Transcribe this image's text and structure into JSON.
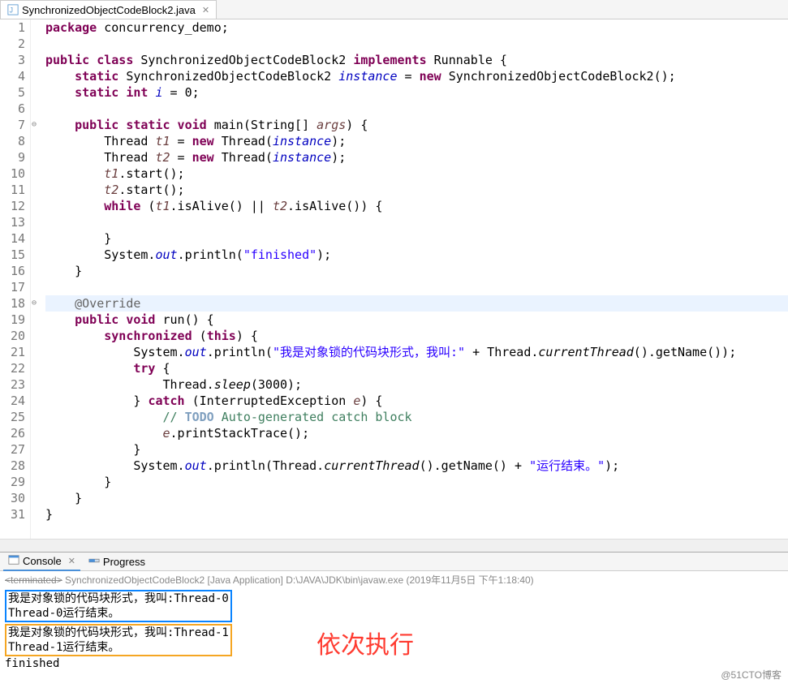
{
  "tab": {
    "filename": "SynchronizedObjectCodeBlock2.java"
  },
  "code": {
    "lines": [
      {
        "n": "1",
        "tokens": [
          [
            "kw",
            "package"
          ],
          [
            "",
            " concurrency_demo;"
          ]
        ]
      },
      {
        "n": "2",
        "tokens": []
      },
      {
        "n": "3",
        "tokens": [
          [
            "kw",
            "public class"
          ],
          [
            "",
            " "
          ],
          [
            "type",
            "SynchronizedObjectCodeBlock2"
          ],
          [
            "",
            " "
          ],
          [
            "kw",
            "implements"
          ],
          [
            "",
            " Runnable {"
          ]
        ]
      },
      {
        "n": "4",
        "tokens": [
          [
            "",
            "    "
          ],
          [
            "kw",
            "static"
          ],
          [
            "",
            " SynchronizedObjectCodeBlock2 "
          ],
          [
            "svar",
            "instance"
          ],
          [
            "",
            " = "
          ],
          [
            "kw",
            "new"
          ],
          [
            "",
            " SynchronizedObjectCodeBlock2();"
          ]
        ]
      },
      {
        "n": "5",
        "tokens": [
          [
            "",
            "    "
          ],
          [
            "kw",
            "static int"
          ],
          [
            "",
            " "
          ],
          [
            "svar",
            "i"
          ],
          [
            "",
            " = 0;"
          ]
        ]
      },
      {
        "n": "6",
        "tokens": []
      },
      {
        "n": "7",
        "fold": true,
        "tokens": [
          [
            "",
            "    "
          ],
          [
            "kw",
            "public static void"
          ],
          [
            "",
            " main(String[] "
          ],
          [
            "var",
            "args"
          ],
          [
            "",
            ") {"
          ]
        ]
      },
      {
        "n": "8",
        "tokens": [
          [
            "",
            "        Thread "
          ],
          [
            "var",
            "t1"
          ],
          [
            "",
            " = "
          ],
          [
            "kw",
            "new"
          ],
          [
            "",
            " Thread("
          ],
          [
            "svar",
            "instance"
          ],
          [
            "",
            ");"
          ]
        ]
      },
      {
        "n": "9",
        "tokens": [
          [
            "",
            "        Thread "
          ],
          [
            "var",
            "t2"
          ],
          [
            "",
            " = "
          ],
          [
            "kw",
            "new"
          ],
          [
            "",
            " Thread("
          ],
          [
            "svar",
            "instance"
          ],
          [
            "",
            ");"
          ]
        ]
      },
      {
        "n": "10",
        "tokens": [
          [
            "",
            "        "
          ],
          [
            "var",
            "t1"
          ],
          [
            "",
            ".start();"
          ]
        ]
      },
      {
        "n": "11",
        "tokens": [
          [
            "",
            "        "
          ],
          [
            "var",
            "t2"
          ],
          [
            "",
            ".start();"
          ]
        ]
      },
      {
        "n": "12",
        "tokens": [
          [
            "",
            "        "
          ],
          [
            "kw",
            "while"
          ],
          [
            "",
            " ("
          ],
          [
            "var",
            "t1"
          ],
          [
            "",
            ".isAlive() || "
          ],
          [
            "var",
            "t2"
          ],
          [
            "",
            ".isAlive()) {"
          ]
        ]
      },
      {
        "n": "13",
        "tokens": []
      },
      {
        "n": "14",
        "tokens": [
          [
            "",
            "        }"
          ]
        ]
      },
      {
        "n": "15",
        "tokens": [
          [
            "",
            "        System."
          ],
          [
            "svar",
            "out"
          ],
          [
            "",
            ".println("
          ],
          [
            "str",
            "\"finished\""
          ],
          [
            "",
            ");"
          ]
        ]
      },
      {
        "n": "16",
        "tokens": [
          [
            "",
            "    }"
          ]
        ]
      },
      {
        "n": "17",
        "tokens": []
      },
      {
        "n": "18",
        "fold": true,
        "hl": true,
        "tokens": [
          [
            "",
            "    "
          ],
          [
            "ann",
            "@Override"
          ]
        ]
      },
      {
        "n": "19",
        "tokens": [
          [
            "",
            "    "
          ],
          [
            "kw",
            "public void"
          ],
          [
            "",
            " run() {"
          ]
        ]
      },
      {
        "n": "20",
        "tokens": [
          [
            "",
            "        "
          ],
          [
            "kw",
            "synchronized"
          ],
          [
            "",
            " ("
          ],
          [
            "kw",
            "this"
          ],
          [
            "",
            ") {"
          ]
        ]
      },
      {
        "n": "21",
        "tokens": [
          [
            "",
            "            System."
          ],
          [
            "svar",
            "out"
          ],
          [
            "",
            ".println("
          ],
          [
            "str",
            "\"我是对象锁的代码块形式，我叫:\""
          ],
          [
            "",
            " + Thread."
          ],
          [
            "smeth",
            "currentThread"
          ],
          [
            "",
            "().getName());"
          ]
        ]
      },
      {
        "n": "22",
        "tokens": [
          [
            "",
            "            "
          ],
          [
            "kw",
            "try"
          ],
          [
            "",
            " {"
          ]
        ]
      },
      {
        "n": "23",
        "tokens": [
          [
            "",
            "                Thread."
          ],
          [
            "smeth",
            "sleep"
          ],
          [
            "",
            "(3000);"
          ]
        ]
      },
      {
        "n": "24",
        "tokens": [
          [
            "",
            "            } "
          ],
          [
            "kw",
            "catch"
          ],
          [
            "",
            " (InterruptedException "
          ],
          [
            "var",
            "e"
          ],
          [
            "",
            ") {"
          ]
        ]
      },
      {
        "n": "25",
        "tokens": [
          [
            "",
            "                "
          ],
          [
            "cmt",
            "// "
          ],
          [
            "todo",
            "TODO"
          ],
          [
            "cmt",
            " Auto-generated catch block"
          ]
        ]
      },
      {
        "n": "26",
        "tokens": [
          [
            "",
            "                "
          ],
          [
            "var",
            "e"
          ],
          [
            "",
            ".printStackTrace();"
          ]
        ]
      },
      {
        "n": "27",
        "tokens": [
          [
            "",
            "            }"
          ]
        ]
      },
      {
        "n": "28",
        "tokens": [
          [
            "",
            "            System."
          ],
          [
            "svar",
            "out"
          ],
          [
            "",
            ".println(Thread."
          ],
          [
            "smeth",
            "currentThread"
          ],
          [
            "",
            "().getName() + "
          ],
          [
            "str",
            "\"运行结束。\""
          ],
          [
            "",
            ");"
          ]
        ]
      },
      {
        "n": "29",
        "tokens": [
          [
            "",
            "        }"
          ]
        ]
      },
      {
        "n": "30",
        "tokens": [
          [
            "",
            "    }"
          ]
        ]
      },
      {
        "n": "31",
        "tokens": [
          [
            "",
            "}"
          ]
        ]
      }
    ]
  },
  "console": {
    "tab_console": "Console",
    "tab_progress": "Progress",
    "header_terminated": "<terminated>",
    "header_rest": " SynchronizedObjectCodeBlock2 [Java Application] D:\\JAVA\\JDK\\bin\\javaw.exe (2019年11月5日 下午1:18:40)",
    "out_blue_l1": "我是对象锁的代码块形式，我叫:Thread-0",
    "out_blue_l2": "Thread-0运行结束。",
    "out_orange_l1": "我是对象锁的代码块形式，我叫:Thread-1",
    "out_orange_l2": "Thread-1运行结束。",
    "out_finished": "finished"
  },
  "annotation": "依次执行",
  "watermark": "@51CTO博客"
}
